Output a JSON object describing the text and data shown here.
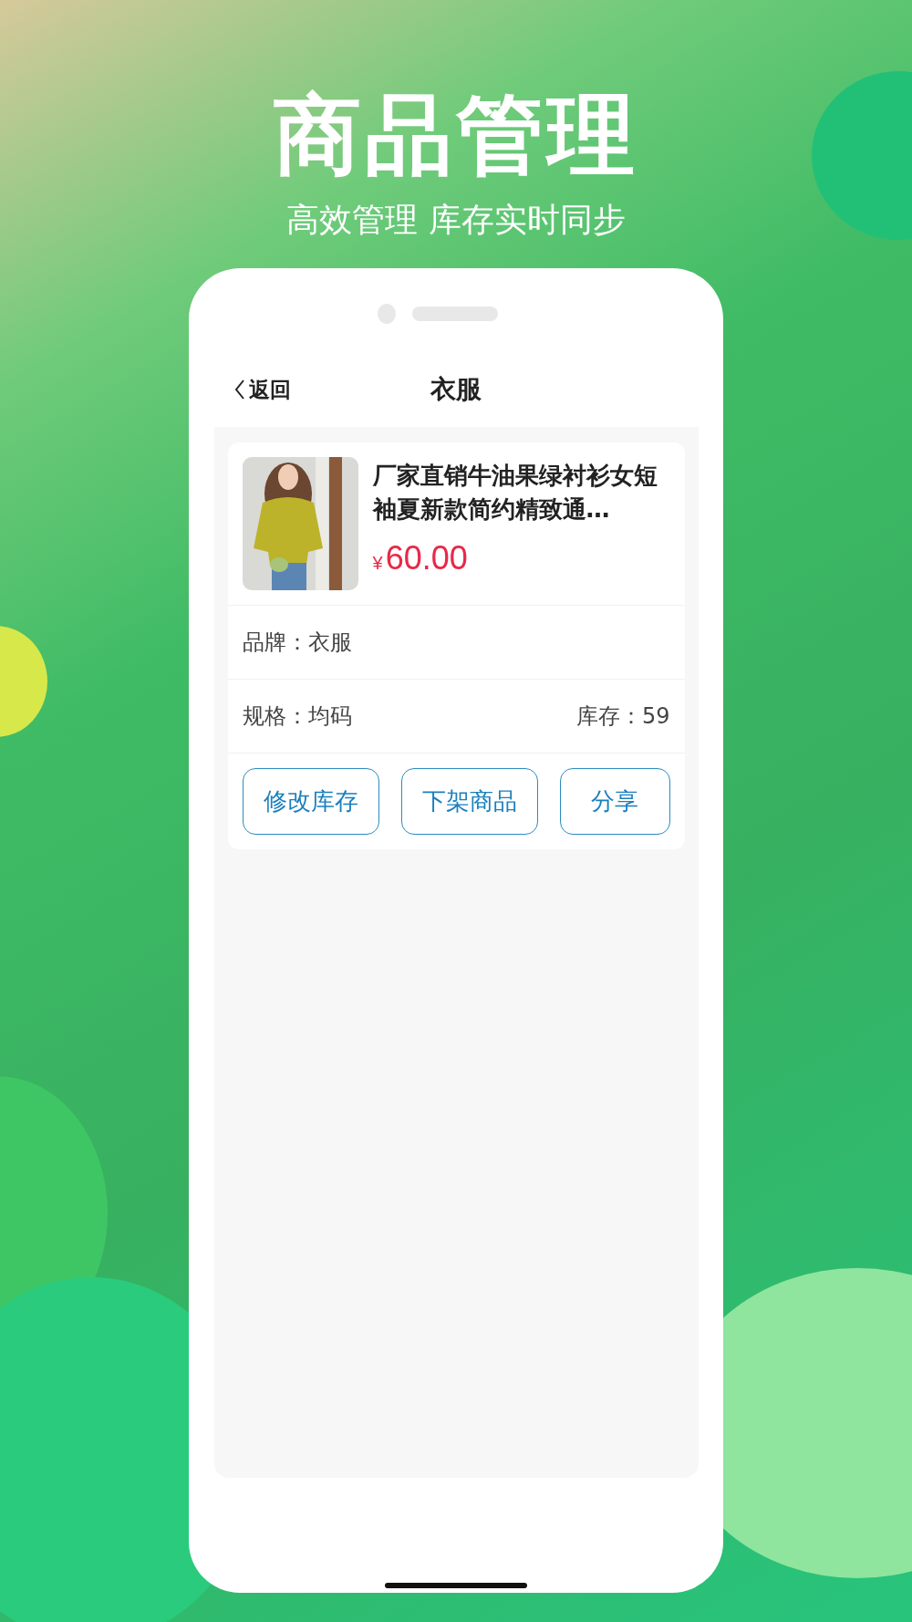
{
  "headline": "商品管理",
  "tagline": "高效管理 库存实时同步",
  "nav": {
    "back": "返回",
    "title": "衣服"
  },
  "product": {
    "title": "厂家直销牛油果绿衬衫女短袖夏新款简约精致通…",
    "currency": "¥",
    "price": "60.00",
    "fields": [
      {
        "label": "品牌：",
        "value": "衣服"
      },
      {
        "label": "规格：",
        "value": "均码",
        "extra_label": "库存：",
        "extra_value": "59"
      }
    ],
    "buttons": [
      "修改库存",
      "下架商品",
      "分享"
    ]
  }
}
